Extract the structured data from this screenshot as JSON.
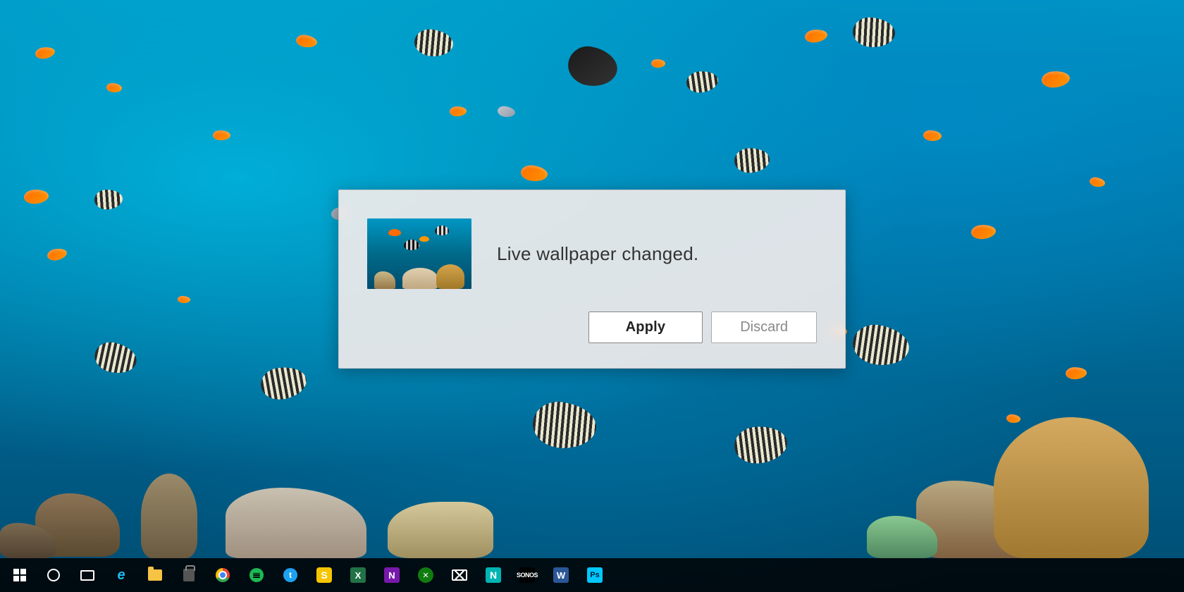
{
  "desktop": {
    "background_description": "Underwater ocean scene with tropical fish and coral"
  },
  "dialog": {
    "message": "Live wallpaper changed.",
    "apply_label": "Apply",
    "discard_label": "Discard",
    "thumbnail_alt": "Underwater wallpaper preview"
  },
  "taskbar": {
    "icons": [
      {
        "name": "windows-start",
        "label": "Start"
      },
      {
        "name": "cortana",
        "label": "Search"
      },
      {
        "name": "task-view",
        "label": "Task View"
      },
      {
        "name": "edge",
        "label": "Microsoft Edge"
      },
      {
        "name": "file-explorer",
        "label": "File Explorer"
      },
      {
        "name": "store",
        "label": "Microsoft Store"
      },
      {
        "name": "chrome",
        "label": "Google Chrome"
      },
      {
        "name": "spotify",
        "label": "Spotify"
      },
      {
        "name": "twitter",
        "label": "Twitter"
      },
      {
        "name": "sway",
        "label": "Microsoft Sway"
      },
      {
        "name": "excel",
        "label": "Microsoft Excel"
      },
      {
        "name": "onenote",
        "label": "Microsoft OneNote"
      },
      {
        "name": "xbox",
        "label": "Xbox"
      },
      {
        "name": "mail",
        "label": "Mail"
      },
      {
        "name": "notepad",
        "label": "Notepad"
      },
      {
        "name": "sonos",
        "label": "Sonos"
      },
      {
        "name": "word",
        "label": "Microsoft Word"
      },
      {
        "name": "photoshop",
        "label": "Adobe Photoshop"
      }
    ]
  }
}
